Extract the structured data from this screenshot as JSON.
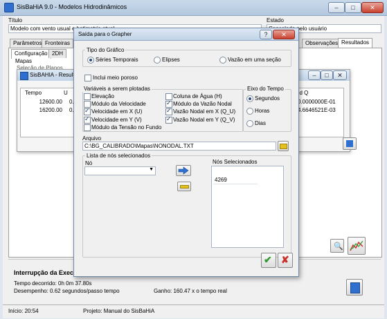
{
  "main_window": {
    "title": "SisBaHiA 9.0 - Modelos Hidrodinâmicos",
    "labels": {
      "titulo": "Título",
      "estado": "Estado"
    },
    "titulo_value": "Modelo com vento usual e batimetria atual",
    "estado_value": "Cancelado pelo usuário",
    "tabs": [
      "Parâmetros",
      "Fronteiras",
      "Observações",
      "Resultados"
    ],
    "subtabs": [
      "Configuração",
      "2DH"
    ],
    "mapas_label": "Mapas",
    "selecao_label": "Seleção de Planos",
    "execution": {
      "title": "Interrupção da Execução",
      "tempo": "Tempo decorrido:  0h  0m 37.80s",
      "desempenho": "Desempenho: 0.62 segundos/passo tempo",
      "ganho": "Ganho: 160.47 x o tempo real"
    },
    "status": {
      "inicio": "Início: 20:54",
      "projeto": "Projeto: Manual do SisBaHiA"
    }
  },
  "results_window": {
    "title": "SisBAHIA - Resultados",
    "columns": [
      "Tempo",
      "U",
      "od Q"
    ],
    "rows": [
      {
        "tempo": "12600.00",
        "u": "0.",
        "q": "0.0000000E-01"
      },
      {
        "tempo": "16200.00",
        "u": "0.",
        "q": "4.6646521E-03"
      }
    ]
  },
  "dialog": {
    "title": "Saída para o Grapher",
    "help_label": "?",
    "close_label": "✕",
    "tipo_grafico": {
      "label": "Tipo do Gráfico",
      "options": [
        "Séries Temporais",
        "Elipses",
        "Vazão em uma seção"
      ],
      "selected": "Séries Temporais"
    },
    "meio_poroso": {
      "label": "Inclui meio poroso",
      "checked": false
    },
    "variaveis": {
      "label": "Variáveis a serem plotadas",
      "left": [
        {
          "label": "Elevação",
          "checked": false
        },
        {
          "label": "Módulo da Velocidade",
          "checked": false
        },
        {
          "label": "Velocidade em X (U)",
          "checked": true
        },
        {
          "label": "Velocidade em Y (V)",
          "checked": true
        },
        {
          "label": "Módulo da Tensão no Fundo",
          "checked": false
        }
      ],
      "right": [
        {
          "label": "Coluna de Água (H)",
          "checked": false
        },
        {
          "label": "Módulo da Vazão Nodal",
          "checked": true
        },
        {
          "label": "Vazão Nodal em X (Q_U)",
          "checked": true
        },
        {
          "label": "Vazão Nodal em Y (Q_V)",
          "checked": true
        }
      ]
    },
    "eixo_tempo": {
      "label": "Eixo do Tempo",
      "options": [
        "Segundos",
        "Horas",
        "Dias"
      ],
      "selected": "Segundos"
    },
    "arquivo": {
      "label": "Arquivo",
      "value": "C:\\BG_CALIBRADO\\Mapas\\NONODAL.TXT"
    },
    "nos": {
      "group_label": "Lista de nós selecionados",
      "no_label": "Nó",
      "no_value": "",
      "selected_label": "Nós Selecionados",
      "selected_items": [
        "4269"
      ]
    },
    "ok_glyph": "✔",
    "cancel_glyph": "✘"
  },
  "colors": {
    "accent_blue": "#2f6fd0",
    "ok_green": "#2c9a2c",
    "cancel_red": "#c8302a",
    "remove_yellow": "#e2c21b"
  }
}
